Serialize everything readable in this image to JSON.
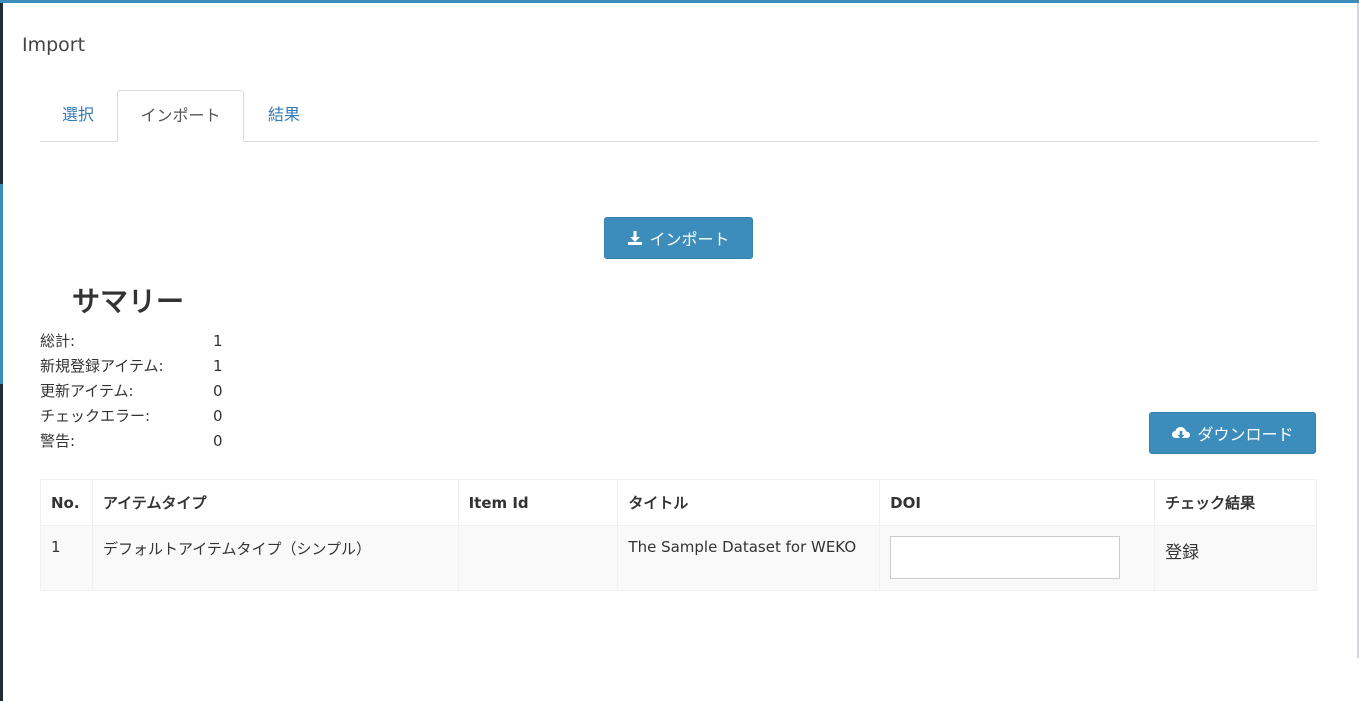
{
  "box": {
    "title": "Import"
  },
  "tabs": [
    {
      "label": "選択",
      "active": false
    },
    {
      "label": "インポート",
      "active": true
    },
    {
      "label": "結果",
      "active": false
    }
  ],
  "import_button": {
    "label": "インポート",
    "icon": "download-icon"
  },
  "summary": {
    "title": "サマリー",
    "rows": [
      {
        "label": "総計:",
        "value": "1"
      },
      {
        "label": "新規登録アイテム:",
        "value": "1"
      },
      {
        "label": "更新アイテム:",
        "value": "0"
      },
      {
        "label": "チェックエラー:",
        "value": "0"
      },
      {
        "label": "警告:",
        "value": "0"
      }
    ]
  },
  "download_button": {
    "label": "ダウンロード",
    "icon": "cloud-download-icon"
  },
  "table": {
    "columns": [
      "No.",
      "アイテムタイプ",
      "Item Id",
      "タイトル",
      "DOI",
      "チェック結果"
    ],
    "rows": [
      {
        "no": "1",
        "item_type": "デフォルトアイテムタイプ（シンプル）",
        "item_id": "",
        "title": "The Sample Dataset for WEKO",
        "doi": "",
        "check_result": "登録"
      }
    ]
  },
  "colors": {
    "accent": "#3c8dbc",
    "link": "#337ab7"
  }
}
